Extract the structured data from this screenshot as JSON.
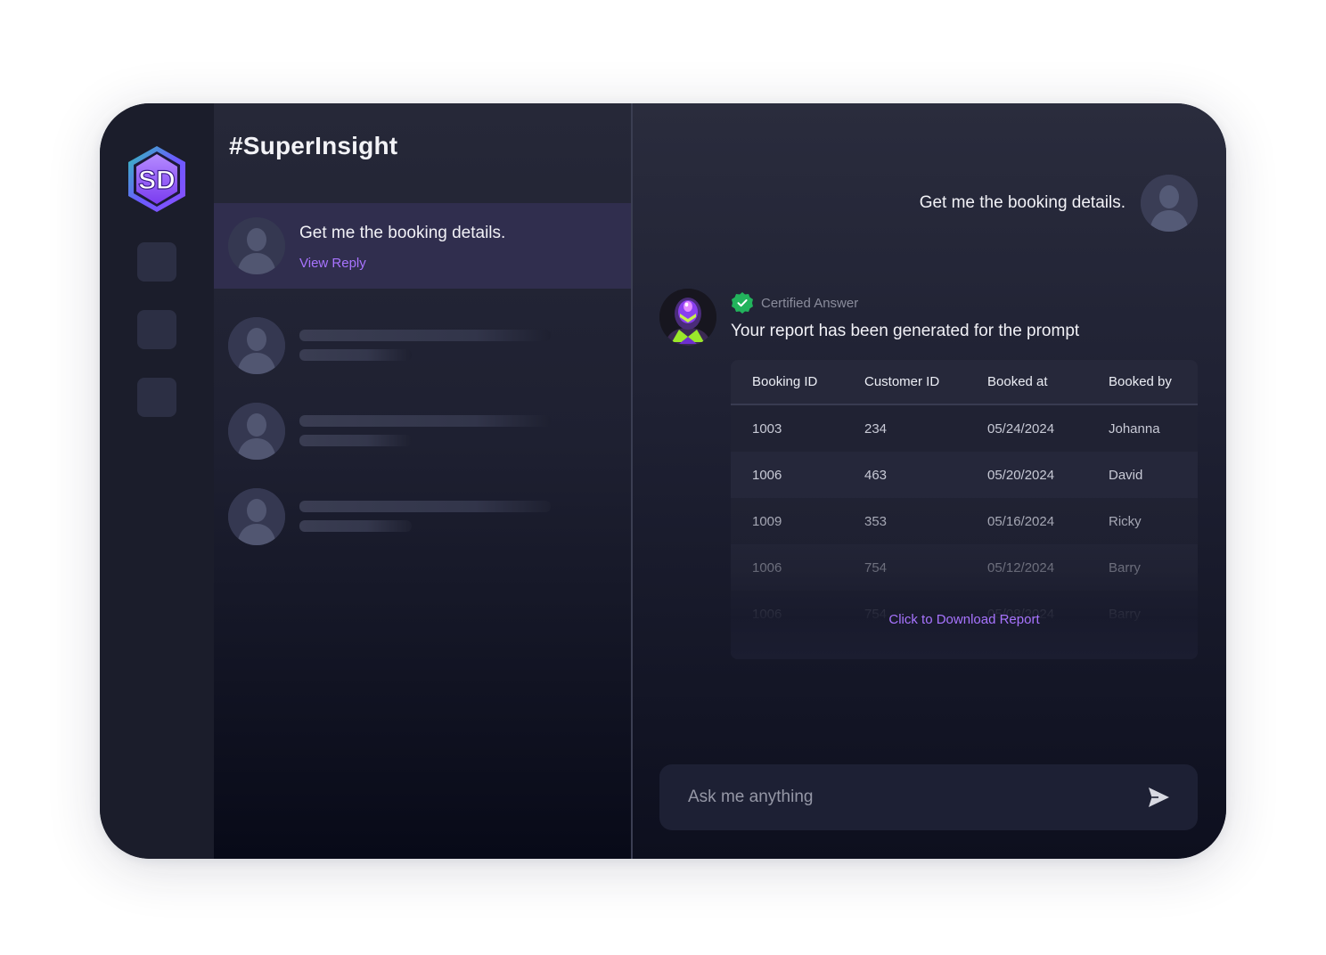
{
  "brand": {
    "logo_text": "SD"
  },
  "sidebar": {
    "title": "#SuperInsight",
    "active_thread": {
      "text": "Get me the booking details.",
      "link": "View Reply"
    }
  },
  "chat": {
    "user_message": "Get me the booking details.",
    "certified_label": "Certified Answer",
    "bot_message": "Your report has been generated for the prompt",
    "table": {
      "headers": [
        "Booking ID",
        "Customer ID",
        "Booked at",
        "Booked by"
      ],
      "rows": [
        [
          "1003",
          "234",
          "05/24/2024",
          "Johanna"
        ],
        [
          "1006",
          "463",
          "05/20/2024",
          "David"
        ],
        [
          "1009",
          "353",
          "05/16/2024",
          "Ricky"
        ],
        [
          "1006",
          "754",
          "05/12/2024",
          "Barry"
        ],
        [
          "1006",
          "754",
          "05/08/2024",
          "Barry"
        ]
      ]
    },
    "download_label": "Click to Download Report",
    "input_placeholder": "Ask me anything"
  },
  "colors": {
    "accent": "#a874ff",
    "certified_green": "#22b35c",
    "logo_purple": "#8b4dff",
    "logo_teal": "#2ec4b6"
  }
}
